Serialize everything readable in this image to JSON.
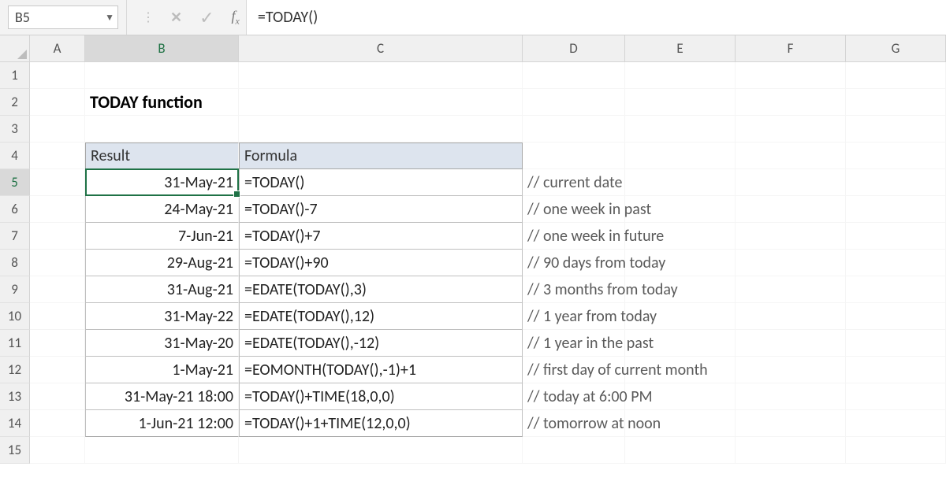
{
  "formula_bar": {
    "cell_ref": "B5",
    "formula": "=TODAY()"
  },
  "columns": [
    "A",
    "B",
    "C",
    "D",
    "E",
    "F",
    "G"
  ],
  "rows": [
    "1",
    "2",
    "3",
    "4",
    "5",
    "6",
    "7",
    "8",
    "9",
    "10",
    "11",
    "12",
    "13",
    "14",
    "15"
  ],
  "title": "TODAY function",
  "active_column_index": 1,
  "active_row_index": 4,
  "table_headers": {
    "result": "Result",
    "formula": "Formula"
  },
  "table": [
    {
      "result": "31-May-21",
      "formula": "=TODAY()",
      "comment": "// current date"
    },
    {
      "result": "24-May-21",
      "formula": "=TODAY()-7",
      "comment": "// one week in past"
    },
    {
      "result": "7-Jun-21",
      "formula": "=TODAY()+7",
      "comment": "// one week in future"
    },
    {
      "result": "29-Aug-21",
      "formula": "=TODAY()+90",
      "comment": "// 90 days from today"
    },
    {
      "result": "31-Aug-21",
      "formula": "=EDATE(TODAY(),3)",
      "comment": "// 3 months from today"
    },
    {
      "result": "31-May-22",
      "formula": "=EDATE(TODAY(),12)",
      "comment": "// 1 year from today"
    },
    {
      "result": "31-May-20",
      "formula": "=EDATE(TODAY(),-12)",
      "comment": "// 1 year in the past"
    },
    {
      "result": "1-May-21",
      "formula": "=EOMONTH(TODAY(),-1)+1",
      "comment": "// first day of current month"
    },
    {
      "result": "31-May-21 18:00",
      "formula": "=TODAY()+TIME(18,0,0)",
      "comment": "// today at 6:00 PM"
    },
    {
      "result": "1-Jun-21 12:00",
      "formula": "=TODAY()+1+TIME(12,0,0)",
      "comment": "// tomorrow at noon"
    }
  ]
}
